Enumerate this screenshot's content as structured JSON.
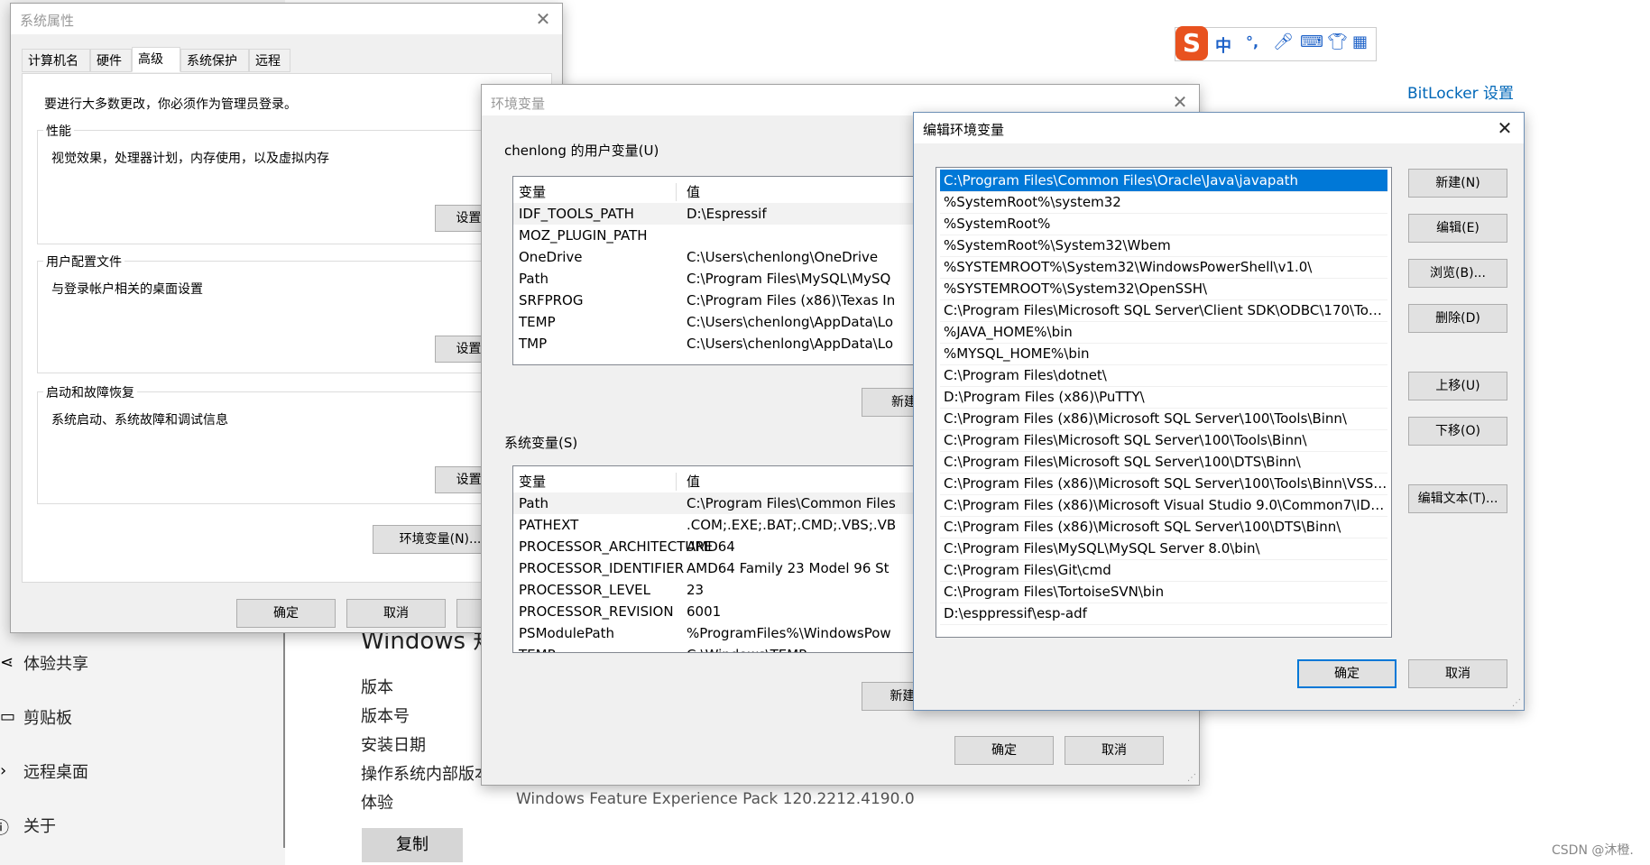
{
  "background": {
    "nav_items": [
      "体验共享",
      "剪贴板",
      "远程桌面",
      "关于"
    ],
    "bitlocker_link": "BitLocker 设置",
    "partial_heading": "Windows 规",
    "info_labels": [
      "版本",
      "版本号",
      "安装日期",
      "操作系统内部版本",
      "体验"
    ],
    "experience_value": "Windows Feature Experience Pack 120.2212.4190.0",
    "copy_button": "复制",
    "watermark": "CSDN @沐橙.",
    "ime_toolbar": [
      "中",
      "°,"
    ]
  },
  "sys_props": {
    "title": "系统属性",
    "tabs": [
      "计算机名",
      "硬件",
      "高级",
      "系统保护",
      "远程"
    ],
    "admin_note": "要进行大多数更改，你必须作为管理员登录。",
    "perf_label": "性能",
    "perf_desc": "视觉效果，处理器计划，内存使用，以及虚拟内存",
    "perf_btn": "设置(S)...",
    "profile_label": "用户配置文件",
    "profile_desc": "与登录帐户相关的桌面设置",
    "profile_btn": "设置(E)...",
    "startup_label": "启动和故障恢复",
    "startup_desc": "系统启动、系统故障和调试信息",
    "startup_btn": "设置(T)...",
    "env_btn": "环境变量(N)...",
    "ok": "确定",
    "cancel": "取消"
  },
  "env_vars": {
    "title": "环境变量",
    "user_label": "chenlong 的用户变量(U)",
    "col_var": "变量",
    "col_val": "值",
    "user_rows": [
      {
        "name": "IDF_TOOLS_PATH",
        "value": "D:\\Espressif"
      },
      {
        "name": "MOZ_PLUGIN_PATH",
        "value": ""
      },
      {
        "name": "OneDrive",
        "value": "C:\\Users\\chenlong\\OneDrive"
      },
      {
        "name": "Path",
        "value": "C:\\Program Files\\MySQL\\MySQ"
      },
      {
        "name": "SRFPROG",
        "value": "C:\\Program Files (x86)\\Texas In"
      },
      {
        "name": "TEMP",
        "value": "C:\\Users\\chenlong\\AppData\\Lo"
      },
      {
        "name": "TMP",
        "value": "C:\\Users\\chenlong\\AppData\\Lo"
      }
    ],
    "user_new_btn": "新建(N",
    "sys_label": "系统变量(S)",
    "sys_rows": [
      {
        "name": "Path",
        "value": "C:\\Program Files\\Common Files"
      },
      {
        "name": "PATHEXT",
        "value": ".COM;.EXE;.BAT;.CMD;.VBS;.VB"
      },
      {
        "name": "PROCESSOR_ARCHITECTURE",
        "value": "AMD64"
      },
      {
        "name": "PROCESSOR_IDENTIFIER",
        "value": "AMD64 Family 23 Model 96 St"
      },
      {
        "name": "PROCESSOR_LEVEL",
        "value": "23"
      },
      {
        "name": "PROCESSOR_REVISION",
        "value": "6001"
      },
      {
        "name": "PSModulePath",
        "value": "%ProgramFiles%\\WindowsPow"
      },
      {
        "name": "TEMP",
        "value": "C:\\Windows\\TEMP"
      }
    ],
    "sys_new_btn": "新建(W",
    "ok": "确定",
    "cancel": "取消"
  },
  "edit_env": {
    "title": "编辑环境变量",
    "items": [
      "C:\\Program Files\\Common Files\\Oracle\\Java\\javapath",
      "%SystemRoot%\\system32",
      "%SystemRoot%",
      "%SystemRoot%\\System32\\Wbem",
      "%SYSTEMROOT%\\System32\\WindowsPowerShell\\v1.0\\",
      "%SYSTEMROOT%\\System32\\OpenSSH\\",
      "C:\\Program Files\\Microsoft SQL Server\\Client SDK\\ODBC\\170\\Too...",
      "%JAVA_HOME%\\bin",
      "%MYSQL_HOME%\\bin",
      "C:\\Program Files\\dotnet\\",
      "D:\\Program Files (x86)\\PuTTY\\",
      "C:\\Program Files (x86)\\Microsoft SQL Server\\100\\Tools\\Binn\\",
      "C:\\Program Files\\Microsoft SQL Server\\100\\Tools\\Binn\\",
      "C:\\Program Files\\Microsoft SQL Server\\100\\DTS\\Binn\\",
      "C:\\Program Files (x86)\\Microsoft SQL Server\\100\\Tools\\Binn\\VSSh...",
      "C:\\Program Files (x86)\\Microsoft Visual Studio 9.0\\Common7\\IDE\\...",
      "C:\\Program Files (x86)\\Microsoft SQL Server\\100\\DTS\\Binn\\",
      "C:\\Program Files\\MySQL\\MySQL Server 8.0\\bin\\",
      "C:\\Program Files\\Git\\cmd",
      "C:\\Program Files\\TortoiseSVN\\bin",
      "D:\\esppressif\\esp-adf"
    ],
    "buttons": {
      "new": "新建(N)",
      "edit": "编辑(E)",
      "browse": "浏览(B)...",
      "delete": "删除(D)",
      "up": "上移(U)",
      "down": "下移(O)",
      "edit_text": "编辑文本(T)..."
    },
    "ok": "确定",
    "cancel": "取消"
  },
  "colors": {
    "selection": "#0078d7",
    "link": "#0067b8",
    "ime_brand": "#e8521f"
  }
}
